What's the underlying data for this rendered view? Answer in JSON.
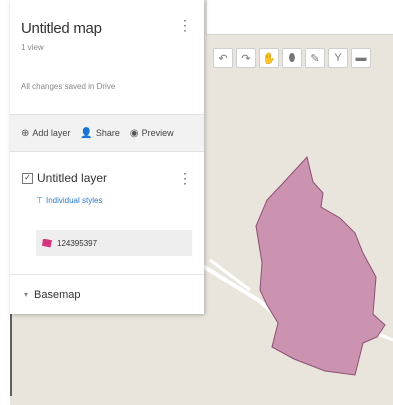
{
  "map": {
    "title": "Untitled map",
    "views": "1 view",
    "save_status": "All changes saved in Drive",
    "actions": [
      {
        "label": "Add layer",
        "icon": "add-layer-icon"
      },
      {
        "label": "Share",
        "icon": "share-icon"
      },
      {
        "label": "Preview",
        "icon": "preview-icon"
      }
    ]
  },
  "layer": {
    "title": "Untitled layer",
    "checked": true,
    "styles_link": "Individual styles",
    "feature_name": "124395397"
  },
  "basemap": {
    "label": "Basemap"
  },
  "toolbar": {
    "tools": [
      "undo-icon",
      "redo-icon",
      "hand-icon",
      "marker-icon",
      "draw-line-icon",
      "route-icon",
      "ruler-icon"
    ]
  },
  "colors": {
    "polygon_fill": "#cb93b0",
    "polygon_stroke": "#8b5074",
    "feature_icon": "#d4357f",
    "link": "#2a79c8",
    "map_bg": "#e9e5dc"
  }
}
